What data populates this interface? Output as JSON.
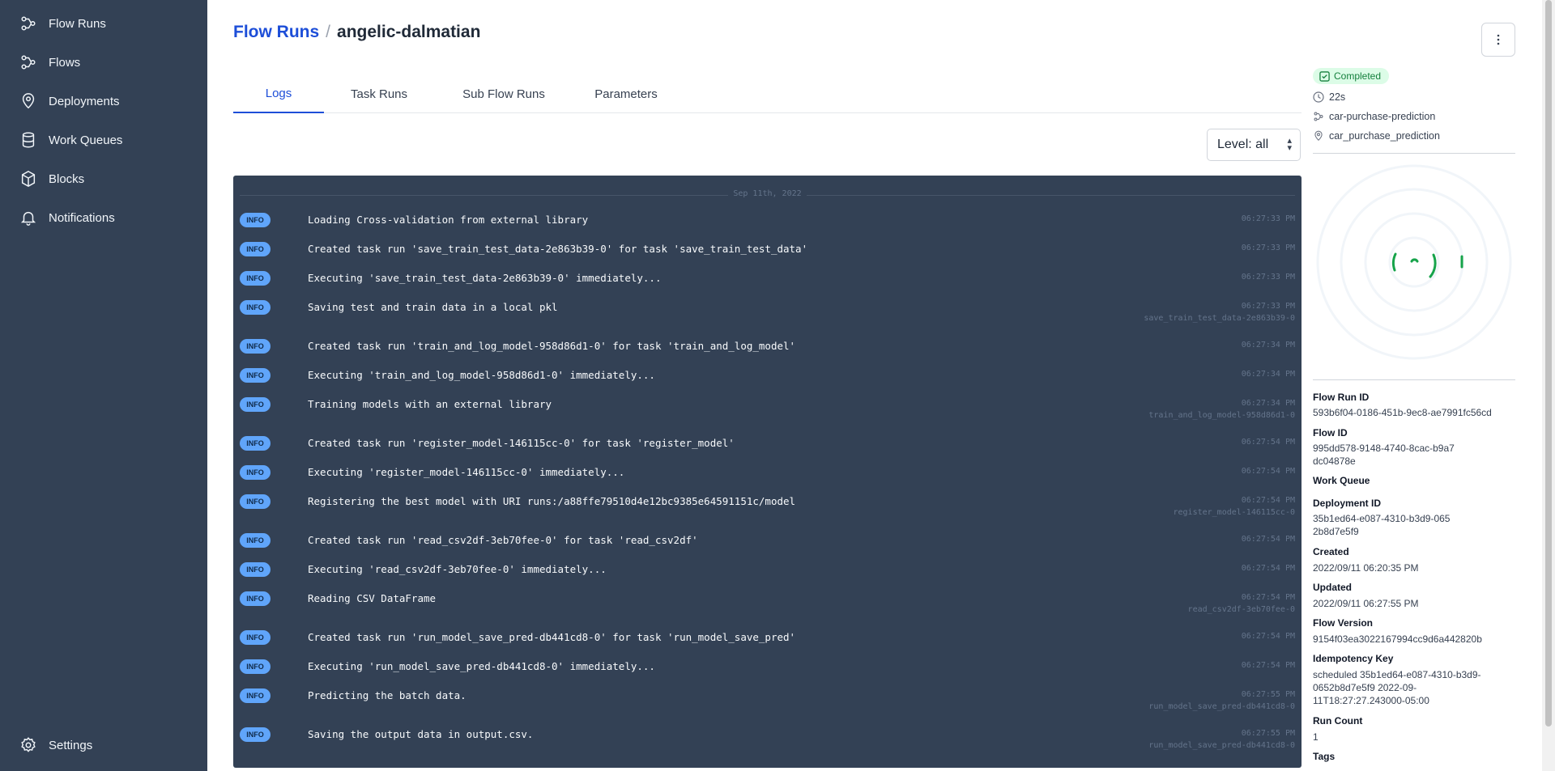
{
  "sidebar": {
    "items": [
      {
        "label": "Flow Runs",
        "icon": "flow-runs-icon"
      },
      {
        "label": "Flows",
        "icon": "flows-icon"
      },
      {
        "label": "Deployments",
        "icon": "map-pin-icon"
      },
      {
        "label": "Work Queues",
        "icon": "database-icon"
      },
      {
        "label": "Blocks",
        "icon": "cube-icon"
      },
      {
        "label": "Notifications",
        "icon": "bell-icon"
      }
    ],
    "settings_label": "Settings"
  },
  "header": {
    "breadcrumb_parent": "Flow Runs",
    "separator": "/",
    "breadcrumb_current": "angelic-dalmatian"
  },
  "tabs": [
    {
      "label": "Logs",
      "active": true
    },
    {
      "label": "Task Runs",
      "active": false
    },
    {
      "label": "Sub Flow Runs",
      "active": false
    },
    {
      "label": "Parameters",
      "active": false
    }
  ],
  "level_select": {
    "value": "Level: all"
  },
  "logs": {
    "date": "Sep 11th, 2022",
    "entries": [
      {
        "level": "INFO",
        "message": "Loading Cross-validation from external library",
        "time": "06:27:33 PM",
        "task": ""
      },
      {
        "level": "INFO",
        "message": "Created task run 'save_train_test_data-2e863b39-0' for task 'save_train_test_data'",
        "time": "06:27:33 PM",
        "task": ""
      },
      {
        "level": "INFO",
        "message": "Executing 'save_train_test_data-2e863b39-0' immediately...",
        "time": "06:27:33 PM",
        "task": ""
      },
      {
        "level": "INFO",
        "message": "Saving test and train data in a local pkl",
        "time": "06:27:33 PM",
        "task": "save_train_test_data-2e863b39-0"
      },
      {
        "level": "INFO",
        "message": "Created task run 'train_and_log_model-958d86d1-0' for task 'train_and_log_model'",
        "time": "06:27:34 PM",
        "task": ""
      },
      {
        "level": "INFO",
        "message": "Executing 'train_and_log_model-958d86d1-0' immediately...",
        "time": "06:27:34 PM",
        "task": ""
      },
      {
        "level": "INFO",
        "message": "Training models with an external library",
        "time": "06:27:34 PM",
        "task": "train_and_log_model-958d86d1-0"
      },
      {
        "level": "INFO",
        "message": "Created task run 'register_model-146115cc-0' for task 'register_model'",
        "time": "06:27:54 PM",
        "task": ""
      },
      {
        "level": "INFO",
        "message": "Executing 'register_model-146115cc-0' immediately...",
        "time": "06:27:54 PM",
        "task": ""
      },
      {
        "level": "INFO",
        "message": "Registering the best model with URI runs:/a88ffe79510d4e12bc9385e64591151c/model",
        "time": "06:27:54 PM",
        "task": "register_model-146115cc-0"
      },
      {
        "level": "INFO",
        "message": "Created task run 'read_csv2df-3eb70fee-0' for task 'read_csv2df'",
        "time": "06:27:54 PM",
        "task": ""
      },
      {
        "level": "INFO",
        "message": "Executing 'read_csv2df-3eb70fee-0' immediately...",
        "time": "06:27:54 PM",
        "task": ""
      },
      {
        "level": "INFO",
        "message": "Reading CSV DataFrame",
        "time": "06:27:54 PM",
        "task": "read_csv2df-3eb70fee-0"
      },
      {
        "level": "INFO",
        "message": "Created task run 'run_model_save_pred-db441cd8-0' for task 'run_model_save_pred'",
        "time": "06:27:54 PM",
        "task": ""
      },
      {
        "level": "INFO",
        "message": "Executing 'run_model_save_pred-db441cd8-0' immediately...",
        "time": "06:27:54 PM",
        "task": ""
      },
      {
        "level": "INFO",
        "message": "Predicting the batch data.",
        "time": "06:27:55 PM",
        "task": "run_model_save_pred-db441cd8-0"
      },
      {
        "level": "INFO",
        "message": "Saving the output data in output.csv.",
        "time": "06:27:55 PM",
        "task": "run_model_save_pred-db441cd8-0"
      }
    ]
  },
  "summary": {
    "state": "Completed",
    "duration": "22s",
    "flow_name": "car-purchase-prediction",
    "deployment_name": "car_purchase_prediction",
    "colors": {
      "completed": "#15803d",
      "completed_bg": "#dcfce7",
      "accent": "#1d4ed8"
    }
  },
  "details": {
    "flow_run_id_label": "Flow Run ID",
    "flow_run_id": "593b6f04-0186-451b-9ec8-ae7991fc56cd",
    "flow_id_label": "Flow ID",
    "flow_id": "995dd578-9148-4740-8cac-b9a7dc04878e",
    "work_queue_label": "Work Queue",
    "deployment_id_label": "Deployment ID",
    "deployment_id": "35b1ed64-e087-4310-b3d9-0652b8d7e5f9",
    "created_label": "Created",
    "created": "2022/09/11 06:20:35 PM",
    "updated_label": "Updated",
    "updated": "2022/09/11 06:27:55 PM",
    "flow_version_label": "Flow Version",
    "flow_version": "9154f03ea3022167994cc9d6a442820b",
    "idempotency_key_label": "Idempotency Key",
    "idempotency_key": "scheduled 35b1ed64-e087-4310-b3d9-0652b8d7e5f9 2022-09-11T18:27:27.243000-05:00",
    "run_count_label": "Run Count",
    "run_count": "1",
    "tags_label": "Tags"
  }
}
